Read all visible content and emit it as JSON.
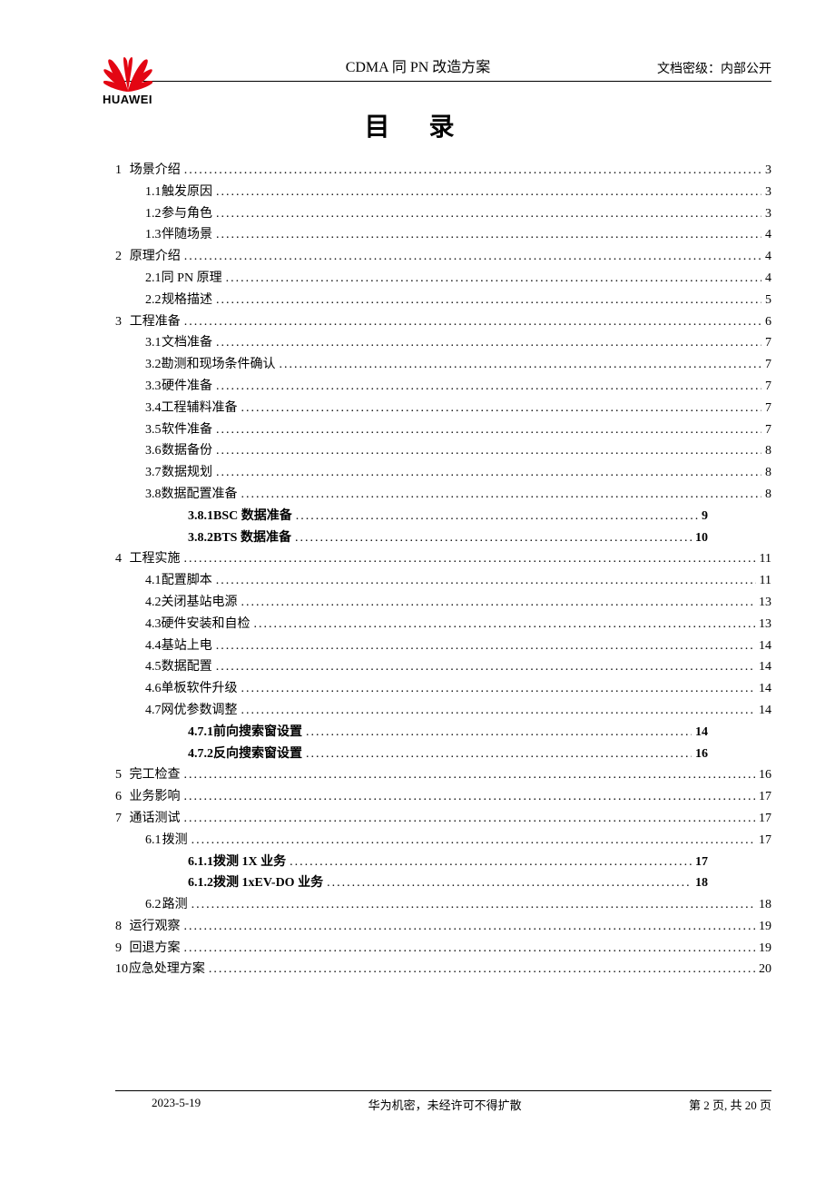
{
  "header": {
    "logo_text": "HUAWEI",
    "doc_title": "CDMA 同 PN 改造方案",
    "classification_label": "文档密级：",
    "classification_value": "内部公开"
  },
  "toc_heading": "目 录",
  "toc": [
    {
      "level": 1,
      "num": "1",
      "title": "场景介绍",
      "page": "3"
    },
    {
      "level": 2,
      "num": "1.1",
      "title": "触发原因",
      "page": "3"
    },
    {
      "level": 2,
      "num": "1.2",
      "title": "参与角色",
      "page": "3"
    },
    {
      "level": 2,
      "num": "1.3",
      "title": "伴随场景",
      "page": "4"
    },
    {
      "level": 1,
      "num": "2",
      "title": "原理介绍",
      "page": "4"
    },
    {
      "level": 2,
      "num": "2.1",
      "title": "同 PN 原理",
      "page": "4"
    },
    {
      "level": 2,
      "num": "2.2",
      "title": "规格描述",
      "page": "5"
    },
    {
      "level": 1,
      "num": "3",
      "title": "工程准备",
      "page": "6"
    },
    {
      "level": 2,
      "num": "3.1",
      "title": "文档准备",
      "page": "7"
    },
    {
      "level": 2,
      "num": "3.2",
      "title": "勘测和现场条件确认",
      "page": "7"
    },
    {
      "level": 2,
      "num": "3.3",
      "title": "硬件准备",
      "page": "7"
    },
    {
      "level": 2,
      "num": "3.4",
      "title": "工程辅料准备",
      "page": "7"
    },
    {
      "level": 2,
      "num": "3.5",
      "title": "软件准备",
      "page": "7"
    },
    {
      "level": 2,
      "num": "3.6",
      "title": "数据备份",
      "page": "8"
    },
    {
      "level": 2,
      "num": "3.7",
      "title": "数据规划",
      "page": "8"
    },
    {
      "level": 2,
      "num": "3.8",
      "title": "数据配置准备",
      "page": "8"
    },
    {
      "level": 3,
      "num": "3.8.1",
      "title": "BSC 数据准备",
      "page": "9"
    },
    {
      "level": 3,
      "num": "3.8.2",
      "title": "BTS 数据准备",
      "page": "10"
    },
    {
      "level": 1,
      "num": "4",
      "title": "工程实施",
      "page": "11"
    },
    {
      "level": 2,
      "num": "4.1",
      "title": "配置脚本",
      "page": "11"
    },
    {
      "level": 2,
      "num": "4.2",
      "title": "关闭基站电源",
      "page": "13"
    },
    {
      "level": 2,
      "num": "4.3",
      "title": "硬件安装和自检",
      "page": "13"
    },
    {
      "level": 2,
      "num": "4.4",
      "title": "基站上电",
      "page": "14"
    },
    {
      "level": 2,
      "num": "4.5",
      "title": "数据配置",
      "page": "14"
    },
    {
      "level": 2,
      "num": "4.6",
      "title": "单板软件升级",
      "page": "14"
    },
    {
      "level": 2,
      "num": "4.7",
      "title": "网优参数调整",
      "page": "14"
    },
    {
      "level": 3,
      "num": "4.7.1",
      "title": "前向搜索窗设置",
      "page": "14"
    },
    {
      "level": 3,
      "num": "4.7.2",
      "title": "反向搜索窗设置",
      "page": "16"
    },
    {
      "level": 1,
      "num": "5",
      "title": "完工检查",
      "page": "16"
    },
    {
      "level": 1,
      "num": "6",
      "title": "业务影响",
      "page": "17"
    },
    {
      "level": 1,
      "num": "7",
      "title": "通话测试",
      "page": "17"
    },
    {
      "level": 2,
      "num": "6.1",
      "title": "拨测",
      "page": "17"
    },
    {
      "level": 3,
      "num": "6.1.1",
      "title": "拨测 1X 业务",
      "page": "17"
    },
    {
      "level": 3,
      "num": "6.1.2",
      "title": "拨测 1xEV-DO 业务",
      "page": "18"
    },
    {
      "level": 2,
      "num": "6.2",
      "title": "路测",
      "page": "18"
    },
    {
      "level": 1,
      "num": "8",
      "title": "运行观察",
      "page": "19"
    },
    {
      "level": 1,
      "num": "9",
      "title": "回退方案",
      "page": "19"
    },
    {
      "level": 1,
      "num": "10",
      "title": "应急处理方案",
      "page": "20"
    }
  ],
  "footer": {
    "date": "2023-5-19",
    "center": "华为机密，未经许可不得扩散",
    "page_label": "第 2 页, 共 20 页"
  }
}
